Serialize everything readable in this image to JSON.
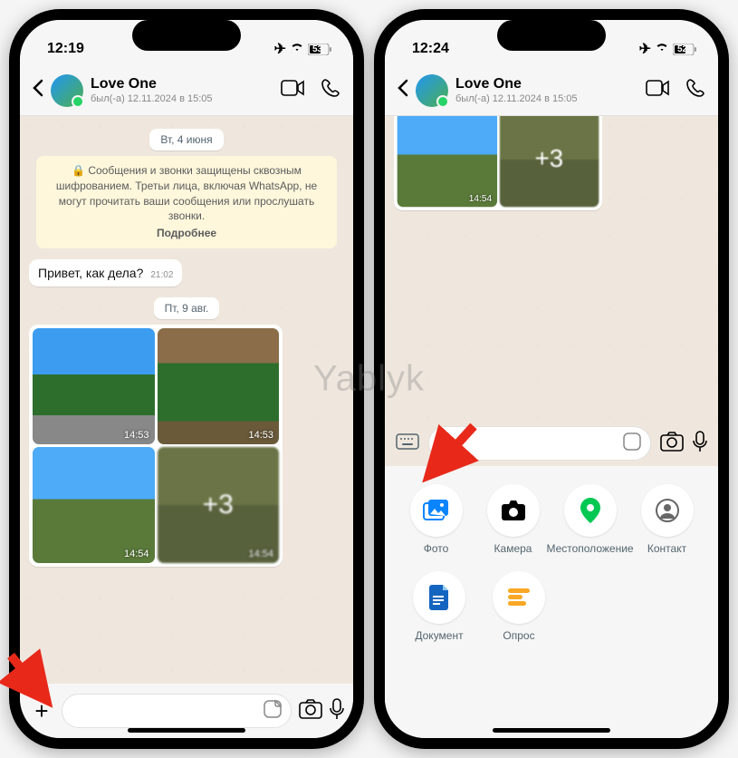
{
  "watermark": "Yablyk",
  "left": {
    "status": {
      "time": "12:19",
      "battery": "53"
    },
    "header": {
      "name": "Love One",
      "status": "был(-а) 12.11.2024 в 15:05"
    },
    "chat": {
      "date1": "Вт, 4 июня",
      "system": {
        "text": "🔒 Сообщения и звонки защищены сквозным шифрованием. Третьи лица, включая WhatsApp, не могут прочитать ваши сообщения или прослушать звонки.",
        "more": "Подробнее"
      },
      "msg1": {
        "text": "Привет, как дела?",
        "time": "21:02"
      },
      "date2": "Пт, 9 авг.",
      "media": {
        "t1": "14:53",
        "t2": "14:53",
        "t3": "14:54",
        "t4": "14:54",
        "more": "+3"
      }
    }
  },
  "right": {
    "status": {
      "time": "12:24",
      "battery": "52"
    },
    "header": {
      "name": "Love One",
      "status": "был(-а) 12.11.2024 в 15:05"
    },
    "media": {
      "t3": "14:54",
      "more": "+3"
    },
    "attach": {
      "photo": "Фото",
      "camera": "Камера",
      "location": "Местоположение",
      "contact": "Контакт",
      "document": "Документ",
      "poll": "Опрос"
    }
  }
}
